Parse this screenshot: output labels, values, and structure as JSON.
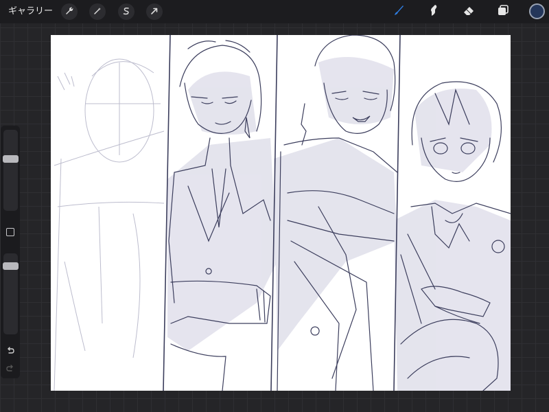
{
  "topbar": {
    "gallery_label": "ギャラリー",
    "left_tools": [
      {
        "name": "actions",
        "icon": "wrench-icon"
      },
      {
        "name": "adjustments",
        "icon": "magic-wand-icon"
      },
      {
        "name": "selection",
        "icon": "selection-s-icon"
      },
      {
        "name": "transform",
        "icon": "arrow-cursor-icon"
      }
    ],
    "right_tools": [
      {
        "name": "brush",
        "icon": "brush-icon",
        "active": true
      },
      {
        "name": "smudge",
        "icon": "smudge-icon"
      },
      {
        "name": "eraser",
        "icon": "eraser-icon"
      },
      {
        "name": "layers",
        "icon": "layers-icon"
      }
    ],
    "current_color": "#24365a",
    "accent_color": "#2f7de1"
  },
  "sidebar": {
    "brush_size_level": 0.65,
    "opacity_level": 0.88,
    "icons": [
      "square-modify-icon",
      "undo-icon",
      "redo-icon"
    ]
  },
  "canvas": {
    "background": "#ffffff",
    "sketch_color": "#3b3d5c",
    "shade_color": "#dcdbe8"
  }
}
